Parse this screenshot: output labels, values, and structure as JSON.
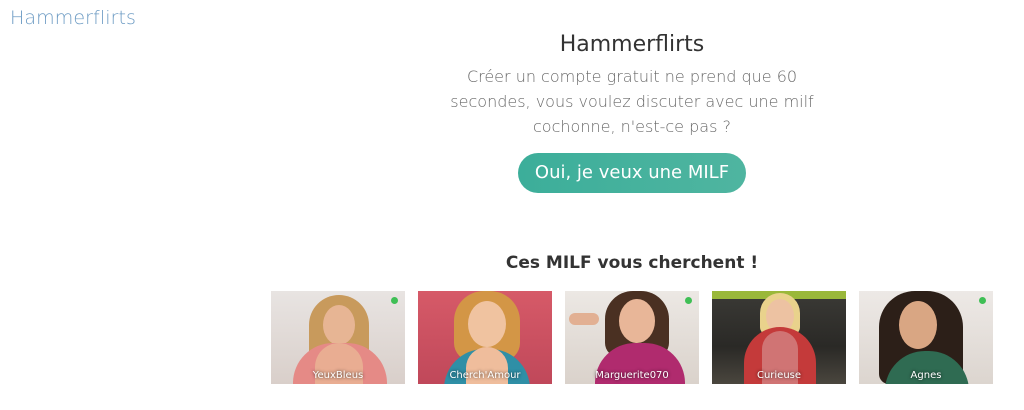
{
  "site": {
    "logo": "Hammerflirts"
  },
  "hero": {
    "title": "Hammerflirts",
    "text": "Créer un compte gratuit ne prend que 60 secondes, vous voulez discuter avec une milf cochonne, n'est-ce pas ?",
    "cta_label": "Oui, je veux une MILF"
  },
  "profiles": {
    "title": "Ces MILF vous cherchent !",
    "items": [
      {
        "name": "YeuxBleus",
        "online": true
      },
      {
        "name": "Cherch'Amour",
        "online": false
      },
      {
        "name": "Marguerite070",
        "online": true
      },
      {
        "name": "Curieuse",
        "online": false
      },
      {
        "name": "Agnes",
        "online": true
      }
    ]
  },
  "colors": {
    "logo": "#6e9cc4",
    "cta": "#3cae9a",
    "online": "#3fbf55"
  }
}
